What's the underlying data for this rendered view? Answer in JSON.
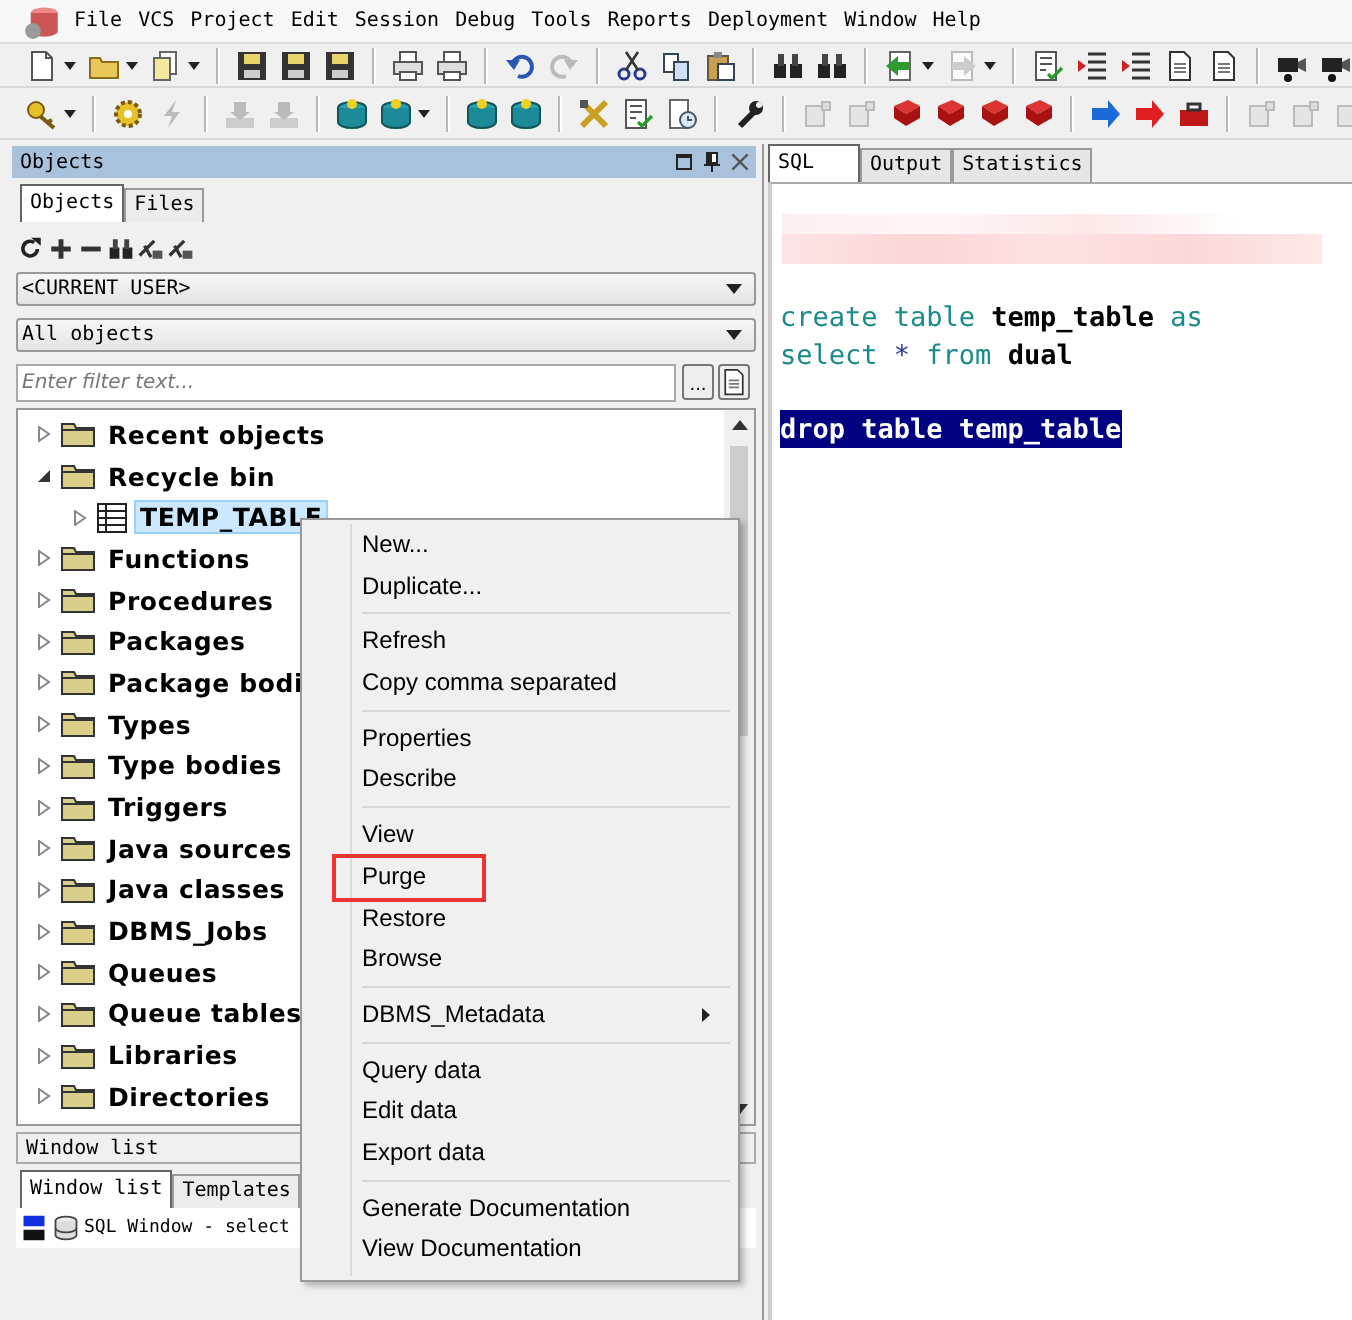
{
  "menu_bar": {
    "items": [
      {
        "label": "File"
      },
      {
        "label": "VCS"
      },
      {
        "label": "Project"
      },
      {
        "label": "Edit"
      },
      {
        "label": "Session"
      },
      {
        "label": "Debug"
      },
      {
        "label": "Tools"
      },
      {
        "label": "Reports"
      },
      {
        "label": "Deployment"
      },
      {
        "label": "Window"
      },
      {
        "label": "Help"
      }
    ]
  },
  "objects_panel": {
    "title": "Objects",
    "tabs": [
      {
        "label": "Objects",
        "selected": true
      },
      {
        "label": "Files",
        "selected": false
      }
    ],
    "owner_select": {
      "value": "<CURRENT USER>"
    },
    "type_select": {
      "value": "All objects"
    },
    "filter": {
      "placeholder": "Enter filter text...",
      "browse_button": "..."
    },
    "tree": [
      {
        "label": "Recent objects",
        "kind": "folder",
        "expanded": false
      },
      {
        "label": "Recycle bin",
        "kind": "folder",
        "expanded": true,
        "children": [
          {
            "label": "TEMP_TABLE",
            "kind": "table",
            "expanded": false,
            "selected": true
          }
        ]
      },
      {
        "label": "Functions",
        "kind": "folder",
        "expanded": false
      },
      {
        "label": "Procedures",
        "kind": "folder",
        "expanded": false
      },
      {
        "label": "Packages",
        "kind": "folder",
        "expanded": false
      },
      {
        "label": "Package bodi",
        "kind": "folder",
        "expanded": false
      },
      {
        "label": "Types",
        "kind": "folder",
        "expanded": false
      },
      {
        "label": "Type bodies",
        "kind": "folder",
        "expanded": false
      },
      {
        "label": "Triggers",
        "kind": "folder",
        "expanded": false
      },
      {
        "label": "Java sources",
        "kind": "folder",
        "expanded": false
      },
      {
        "label": "Java classes",
        "kind": "folder",
        "expanded": false
      },
      {
        "label": "DBMS_Jobs",
        "kind": "folder",
        "expanded": false
      },
      {
        "label": "Queues",
        "kind": "folder",
        "expanded": false
      },
      {
        "label": "Queue tables",
        "kind": "folder",
        "expanded": false
      },
      {
        "label": "Libraries",
        "kind": "folder",
        "expanded": false
      },
      {
        "label": "Directories",
        "kind": "folder",
        "expanded": false
      }
    ]
  },
  "window_list": {
    "title": "Window list",
    "tabs": [
      {
        "label": "Window list",
        "selected": true
      },
      {
        "label": "Templates",
        "selected": false
      }
    ],
    "items": [
      {
        "label": "SQL Window - select"
      }
    ]
  },
  "editor": {
    "tabs": [
      {
        "label": "SQL",
        "selected": true
      },
      {
        "label": "Output",
        "selected": false
      },
      {
        "label": "Statistics",
        "selected": false
      }
    ],
    "lines": [
      {
        "selected": false,
        "blank_before": false,
        "tokens": [
          {
            "text": "create",
            "kind": "keyword"
          },
          {
            "text": "table",
            "kind": "keyword"
          },
          {
            "text": "temp_table",
            "kind": "name"
          },
          {
            "text": "as",
            "kind": "keyword"
          }
        ]
      },
      {
        "selected": false,
        "blank_before": false,
        "tokens": [
          {
            "text": "select",
            "kind": "keyword"
          },
          {
            "text": "*",
            "kind": "operator"
          },
          {
            "text": "from",
            "kind": "keyword"
          },
          {
            "text": "dual",
            "kind": "name"
          }
        ]
      },
      {
        "selected": true,
        "blank_before": true,
        "tokens": [
          {
            "text": "drop",
            "kind": "keyword"
          },
          {
            "text": "table",
            "kind": "keyword"
          },
          {
            "text": "temp_table",
            "kind": "name"
          }
        ]
      }
    ]
  },
  "context_menu": {
    "groups": [
      [
        {
          "label": "New...",
          "submenu": false,
          "framed": false
        },
        {
          "label": "Duplicate...",
          "submenu": false,
          "framed": false
        }
      ],
      [
        {
          "label": "Refresh",
          "submenu": false,
          "framed": false
        },
        {
          "label": "Copy comma separated",
          "submenu": false,
          "framed": false
        }
      ],
      [
        {
          "label": "Properties",
          "submenu": false,
          "framed": false
        },
        {
          "label": "Describe",
          "submenu": false,
          "framed": false
        }
      ],
      [
        {
          "label": "View",
          "submenu": false,
          "framed": false
        },
        {
          "label": "Purge",
          "submenu": false,
          "framed": true
        },
        {
          "label": "Restore",
          "submenu": false,
          "framed": false
        },
        {
          "label": "Browse",
          "submenu": false,
          "framed": false
        }
      ],
      [
        {
          "label": "DBMS_Metadata",
          "submenu": true,
          "framed": false
        }
      ],
      [
        {
          "label": "Query data",
          "submenu": false,
          "framed": false
        },
        {
          "label": "Edit data",
          "submenu": false,
          "framed": false
        },
        {
          "label": "Export data",
          "submenu": false,
          "framed": false
        }
      ],
      [
        {
          "label": "Generate Documentation",
          "submenu": false,
          "framed": false
        },
        {
          "label": "View Documentation",
          "submenu": false,
          "framed": false
        }
      ]
    ]
  }
}
